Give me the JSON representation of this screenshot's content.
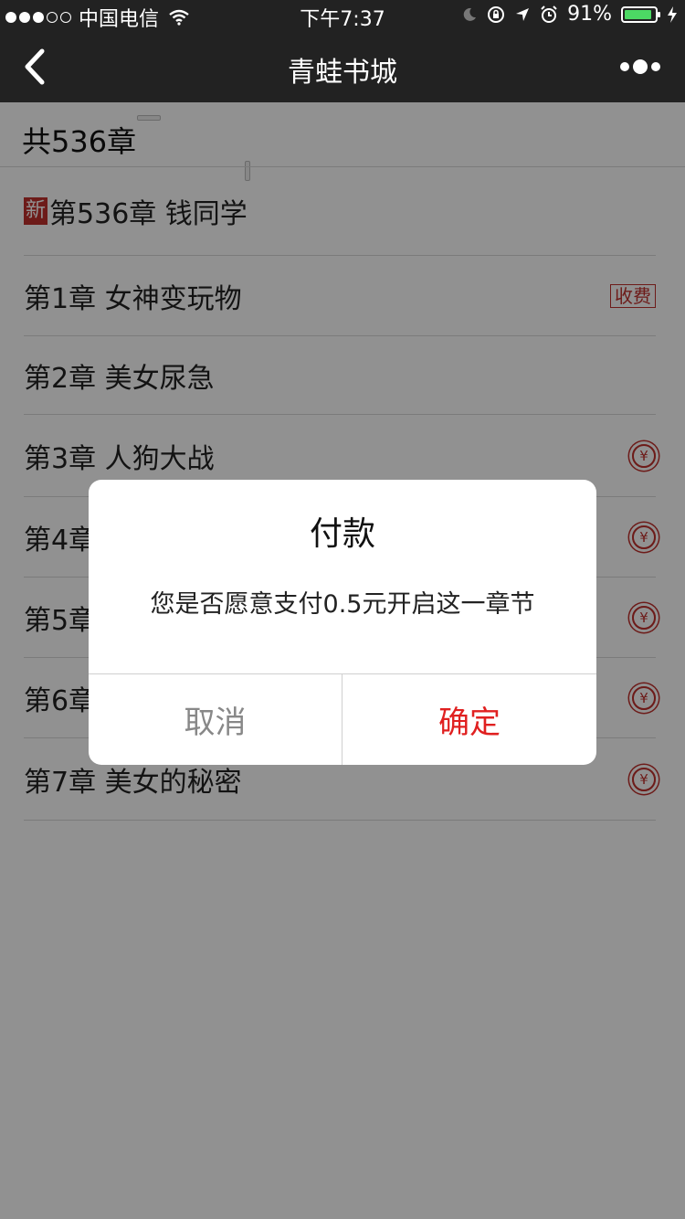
{
  "status_bar": {
    "carrier": "中国电信",
    "time": "下午7:37",
    "battery_text": "91%",
    "battery_level": 0.91,
    "battery_color": "#4cd964",
    "icons": [
      "signal-dots",
      "wifi-icon",
      "moon-icon",
      "rotation-lock-icon",
      "location-icon",
      "alarm-icon",
      "battery-icon",
      "charging-icon"
    ]
  },
  "nav": {
    "title": "青蛙书城",
    "back_icon": "chevron-left-icon",
    "more_icon": "more-dots-icon"
  },
  "chapter_list": {
    "count_label": "共536章",
    "new_badge": "新",
    "fee_badge": "收费",
    "latest": {
      "title": "第536章 钱同学"
    },
    "chapters": [
      {
        "title": "第1章 女神变玩物",
        "marker": "fee-badge"
      },
      {
        "title": "第2章 美女尿急",
        "marker": "none"
      },
      {
        "title": "第3章 人狗大战",
        "marker": "yen-icon"
      },
      {
        "title": "第4章",
        "marker": "yen-icon"
      },
      {
        "title": "第5章",
        "marker": "yen-icon"
      },
      {
        "title": "第6章",
        "marker": "yen-icon"
      },
      {
        "title": "第7章 美女的秘密",
        "marker": "yen-icon"
      }
    ]
  },
  "dialog": {
    "title": "付款",
    "message": "您是否愿意支付0.5元开启这一章节",
    "cancel_label": "取消",
    "confirm_label": "确定"
  },
  "colors": {
    "header_bg": "#222222",
    "accent_red": "#c0302c",
    "confirm_red": "#e02020",
    "cancel_gray": "#888888"
  }
}
